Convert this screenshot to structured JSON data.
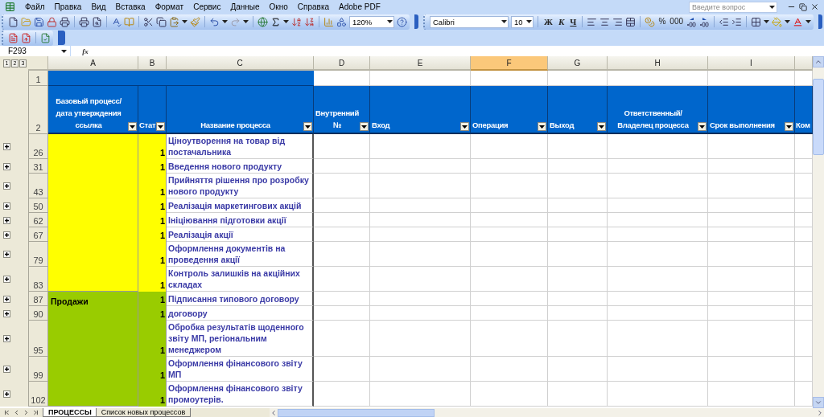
{
  "menu": {
    "items": [
      "Файл",
      "Правка",
      "Вид",
      "Вставка",
      "Формат",
      "Сервис",
      "Данные",
      "Окно",
      "Справка",
      "Adobe PDF"
    ],
    "help_search": {
      "placeholder": "Введите вопрос"
    }
  },
  "toolbar": {
    "zoom": "120%",
    "font": "Calibri",
    "font_size": "10",
    "bold": "Ж",
    "italic": "К",
    "underline": "Ч",
    "percent": "%",
    "thousands": "000"
  },
  "formula_bar": {
    "name_box": "F293",
    "function_label": "fx"
  },
  "sheet": {
    "outline_levels": [
      "1",
      "2",
      "3"
    ],
    "header_row_numbers": [
      "1",
      "2"
    ],
    "columns": [
      {
        "letter": "A",
        "selected": false,
        "heading": "Базовый процесс/ дата утверждения ссылка"
      },
      {
        "letter": "B",
        "selected": false,
        "heading": "Стат"
      },
      {
        "letter": "C",
        "selected": false,
        "heading": "Название процесса"
      },
      {
        "letter": "D",
        "selected": false,
        "heading": "Внутренний №"
      },
      {
        "letter": "E",
        "selected": false,
        "heading": "Вход"
      },
      {
        "letter": "F",
        "selected": true,
        "heading": "Операция"
      },
      {
        "letter": "G",
        "selected": false,
        "heading": "Выход"
      },
      {
        "letter": "H",
        "selected": false,
        "heading": "Ответственный/Владелец процесса"
      },
      {
        "letter": "I",
        "selected": false,
        "heading": "Срок выполнения"
      },
      {
        "heading": "Ком"
      }
    ],
    "groups": [
      {
        "color": "#ffff00",
        "rows": [
          {
            "number": "26",
            "status": "1",
            "name": "Ціноутворення на товар від постачальника"
          },
          {
            "number": "31",
            "status": "1",
            "name": "Введення нового продукту"
          },
          {
            "number": "43",
            "status": "1",
            "name": "Прийняття рішення про розробку нового продукту"
          },
          {
            "number": "50",
            "status": "1",
            "name": "Реалізація маркетингових акцій"
          },
          {
            "number": "62",
            "status": "1",
            "name": "Ініціювання підготовки акції"
          },
          {
            "number": "67",
            "status": "1",
            "name": "Реалізація акції"
          },
          {
            "number": "79",
            "status": "1",
            "name": "Оформлення документів на проведення акції"
          },
          {
            "number": "83",
            "status": "1",
            "name": "Контроль залишків на акційних складах"
          }
        ]
      },
      {
        "color": "#99cc00",
        "label": "Продажи",
        "rows": [
          {
            "number": "87",
            "status": "1",
            "name": "Підписання типового договору"
          },
          {
            "number": "90",
            "status": "1",
            "name": "договору"
          },
          {
            "number": "95",
            "status": "1",
            "name": "Обробка результатів щоденного звіту МП, регіональним менеджером"
          },
          {
            "number": "99",
            "status": "1",
            "name": "Оформлення фінансового звіту МП"
          },
          {
            "number": "102",
            "status": "1",
            "name": "Оформлення фінансового звіту промоутерів."
          }
        ]
      }
    ]
  },
  "sheet_tabs": [
    {
      "label": "ПРОЦЕССЫ",
      "selected": true
    },
    {
      "label": "Список новых процессов",
      "selected": false
    }
  ]
}
